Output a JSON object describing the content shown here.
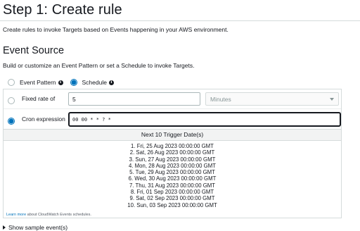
{
  "page": {
    "title": "Step 1: Create rule",
    "description": "Create rules to invoke Targets based on Events happening in your AWS environment."
  },
  "event_source": {
    "title": "Event Source",
    "description": "Build or customize an Event Pattern or set a Schedule to invoke Targets.",
    "modes": [
      {
        "label": "Event Pattern",
        "selected": false,
        "icon": "info-icon"
      },
      {
        "label": "Schedule",
        "selected": true,
        "icon": "info-icon"
      }
    ]
  },
  "schedule": {
    "fixed_rate": {
      "label": "Fixed rate of",
      "selected": false,
      "value": "5",
      "unit": "Minutes"
    },
    "cron": {
      "label": "Cron expression",
      "selected": true,
      "value": "00 00 * * ? *"
    }
  },
  "triggers": {
    "header": "Next 10 Trigger Date(s)",
    "dates": [
      "1. Fri, 25 Aug 2023 00:00:00 GMT",
      "2. Sat, 26 Aug 2023 00:00:00 GMT",
      "3. Sun, 27 Aug 2023 00:00:00 GMT",
      "4. Mon, 28 Aug 2023 00:00:00 GMT",
      "5. Tue, 29 Aug 2023 00:00:00 GMT",
      "6. Wed, 30 Aug 2023 00:00:00 GMT",
      "7. Thu, 31 Aug 2023 00:00:00 GMT",
      "8. Fri, 01 Sep 2023 00:00:00 GMT",
      "9. Sat, 02 Sep 2023 00:00:00 GMT",
      "10. Sun, 03 Sep 2023 00:00:00 GMT"
    ]
  },
  "learn_more": {
    "link": "Learn more",
    "text": " about CloudWatch Events schedules."
  },
  "show_sample": {
    "label": "Show sample event(s)",
    "icon": "caret-right-icon"
  },
  "colors": {
    "accent": "#0073bb",
    "border": "#d5dbdb",
    "text": "#16191f"
  }
}
